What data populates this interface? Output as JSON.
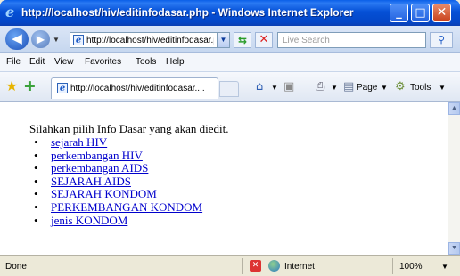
{
  "window": {
    "title": "http://localhost/hiv/editinfodasar.php - Windows Internet Explorer",
    "min_glyph": "_",
    "max_glyph": "□",
    "close_glyph": "✕"
  },
  "address": {
    "url": "http://localhost/hiv/editinfodasar.php",
    "search_placeholder": "Live Search"
  },
  "menu": [
    "File",
    "Edit",
    "View",
    "Favorites",
    "Tools",
    "Help"
  ],
  "tab": {
    "label": "http://localhost/hiv/editinfodasar...."
  },
  "commands": {
    "page": "Page",
    "tools": "Tools"
  },
  "content": {
    "intro": "Silahkan pilih Info Dasar yang akan diedit.",
    "links": [
      "sejarah HIV",
      "perkembangan HIV",
      "perkembangan AIDS",
      "SEJARAH AIDS",
      "SEJARAH KONDOM",
      "PERKEMBANGAN KONDOM",
      "jenis KONDOM"
    ]
  },
  "status": {
    "text": "Done",
    "zone": "Internet",
    "zoom": "100%"
  },
  "icons": {
    "back": "back-arrow-icon",
    "forward": "forward-arrow-icon",
    "refresh": "refresh-icon",
    "stop": "stop-icon",
    "search": "search-icon",
    "favorites": "favorites-star-icon",
    "add_favorites": "add-favorites-icon",
    "home": "home-icon",
    "feeds": "feeds-icon",
    "print": "print-icon",
    "page": "page-icon",
    "tools": "gear-icon"
  },
  "colors": {
    "titlebar": "#0550d6",
    "link": "#0000cc",
    "close_button": "#c9411b"
  }
}
